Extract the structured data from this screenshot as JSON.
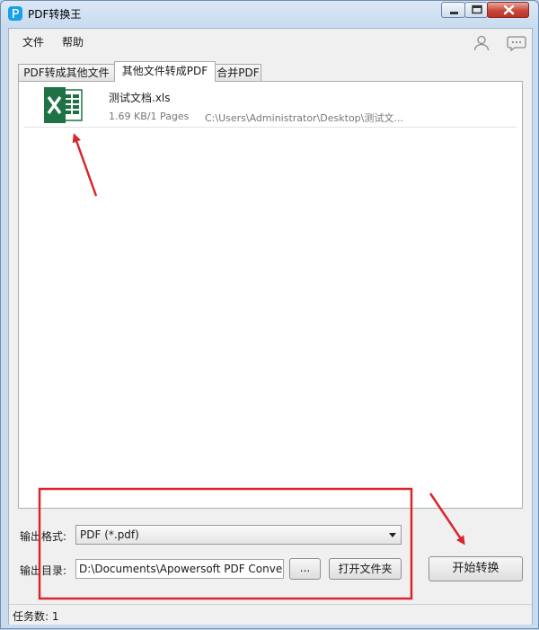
{
  "window": {
    "title": "PDF转换王"
  },
  "menu": {
    "file": "文件",
    "help": "帮助"
  },
  "menu_icons": [
    "user-icon",
    "chat-icon"
  ],
  "tabs": [
    {
      "label": "PDF转成其他文件",
      "active": false
    },
    {
      "label": "其他文件转成PDF",
      "active": true
    },
    {
      "label": "合并PDF",
      "active": false
    }
  ],
  "file_list": [
    {
      "name": "测试文档.xls",
      "meta": "1.69 KB/1 Pages",
      "path": "C:\\Users\\Administrator\\Desktop\\测试文..."
    }
  ],
  "output": {
    "format_label": "输出格式:",
    "format_value": "PDF (*.pdf)",
    "dir_label": "输出目录:",
    "dir_value": "D:\\Documents\\Apowersoft PDF Conver",
    "browse_label": "...",
    "open_folder_label": "打开文件夹"
  },
  "start_button": "开始转换",
  "status": {
    "tasks": "任务数: 1"
  },
  "colors": {
    "annotation_red": "#d8262c",
    "excel_green": "#1f7244",
    "titlebar": "#c8dbef"
  }
}
